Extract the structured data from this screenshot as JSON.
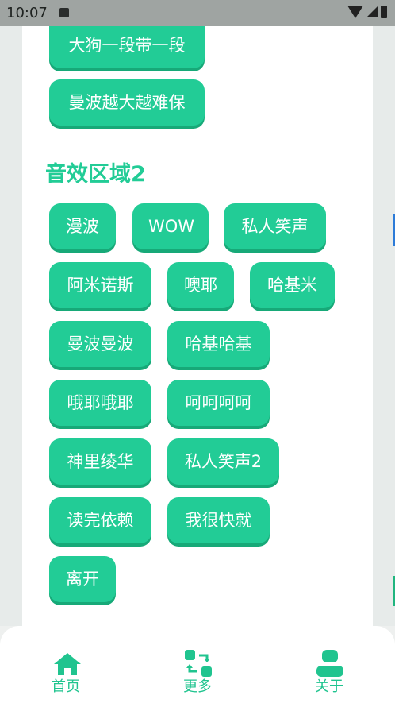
{
  "status_bar": {
    "time": "10:07"
  },
  "top_partial_chip": "",
  "sections": {
    "section1": {
      "buttons": [
        "大狗一段带一段",
        "曼波越大越难保"
      ]
    },
    "section2": {
      "title": "音效区域2",
      "buttons": [
        "漫波",
        "WOW",
        "私人笑声",
        "阿米诺斯",
        "噢耶",
        "哈基米",
        "曼波曼波",
        "哈基哈基",
        "哦耶哦耶",
        "呵呵呵呵",
        "神里绫华",
        "私人笑声2",
        "读完依赖",
        "我很快就",
        "离开"
      ]
    }
  },
  "bottom_nav": {
    "items": [
      {
        "label": "首页",
        "icon": "home-icon"
      },
      {
        "label": "更多",
        "icon": "more-icon"
      },
      {
        "label": "关于",
        "icon": "about-icon"
      }
    ]
  },
  "colors": {
    "accent": "#22cc96",
    "accent_shadow": "#17a978",
    "status_bar_bg": "#9fa4a2"
  }
}
